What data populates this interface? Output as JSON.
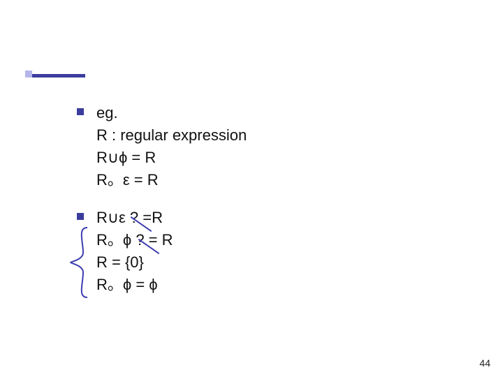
{
  "accent": {
    "bar_color": "#3c3c9e",
    "box_color": "#b6b6ec"
  },
  "bullets": [
    {
      "lines": [
        "eg.",
        "R : regular expression",
        "R∪ϕ = R",
        "R。ε = R"
      ]
    },
    {
      "lines": [
        "R∪ε ? =R",
        "R。ϕ ? = R",
        "R = {0}",
        "R。ϕ = ϕ"
      ]
    }
  ],
  "page_number": "44"
}
